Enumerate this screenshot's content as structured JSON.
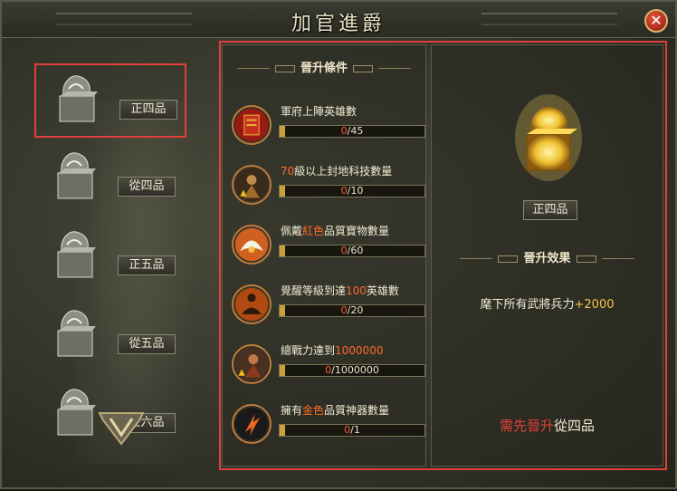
{
  "window": {
    "title": "加官進爵",
    "close_label": "✕"
  },
  "rank_list": {
    "items": [
      {
        "label": "正四品",
        "selected": true
      },
      {
        "label": "從四品",
        "selected": false
      },
      {
        "label": "正五品",
        "selected": false
      },
      {
        "label": "從五品",
        "selected": false
      },
      {
        "label": "正六品",
        "selected": false
      }
    ]
  },
  "conditions": {
    "heading": "晉升條件",
    "items": [
      {
        "pre": "軍府上陣英雄數",
        "hl": "",
        "post": "",
        "current": "0",
        "total": "/45",
        "icon": "army-emblem-icon"
      },
      {
        "pre": "",
        "hl": "70",
        "post": "級以上封地科技數量",
        "current": "0",
        "total": "/10",
        "icon": "warrior-upgrade-icon"
      },
      {
        "pre": "佩戴",
        "hl": "紅色",
        "post": "品質寶物數量",
        "current": "0",
        "total": "/60",
        "icon": "wing-treasure-icon"
      },
      {
        "pre": "覺醒等級到達",
        "hl": "100",
        "post": "英雄數",
        "current": "0",
        "total": "/20",
        "icon": "meditation-icon"
      },
      {
        "pre": "總戰力達到",
        "hl": "1000000",
        "post": "",
        "current": "0",
        "total": "/1000000",
        "icon": "power-upgrade-icon"
      },
      {
        "pre": "擁有",
        "hl": "金色",
        "post": "品質神器數量",
        "current": "0",
        "total": "/1",
        "icon": "artifact-icon"
      }
    ]
  },
  "effect": {
    "rank_label": "正四品",
    "heading": "晉升效果",
    "text": "麾下所有武將兵力",
    "value": "+2000",
    "requirement_warn": "需先晉升",
    "requirement_rank": "從四品"
  },
  "colors": {
    "highlight": "#ff6a2a",
    "frame_red": "#e0403a",
    "gold": "#f4c64a"
  }
}
